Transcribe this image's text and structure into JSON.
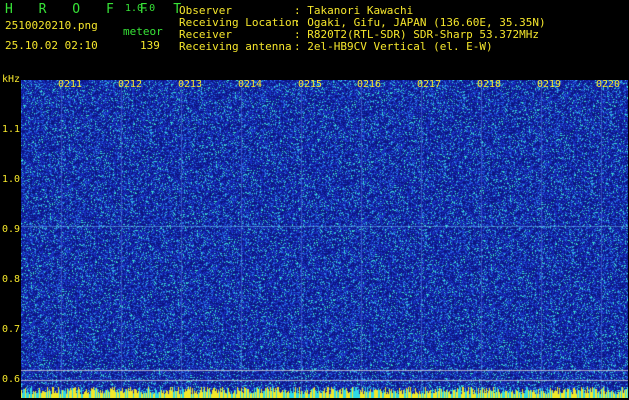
{
  "app": {
    "logo": "H R O F F T",
    "version": "1.0.0"
  },
  "left_info": {
    "filename": "2510020210.png",
    "mode_label": "meteor",
    "datetime": "25.10.02 02:10",
    "count": "139"
  },
  "station": [
    {
      "label": "Observer",
      "value": ": Takanori Kawachi"
    },
    {
      "label": "Receiving Location",
      "value": ": Ogaki, Gifu, JAPAN (136.60E, 35.35N)"
    },
    {
      "label": "Receiver",
      "value": ": R820T2(RTL-SDR) SDR-Sharp 53.372MHz"
    },
    {
      "label": "Receiving antenna",
      "value": ": 2el-HB9CV Vertical (el. E-W)"
    }
  ],
  "axis": {
    "y_unit": "kHz",
    "y_ticks": [
      "1.1",
      "1.0",
      "0.9",
      "0.8",
      "0.7",
      "0.6"
    ],
    "x_ticks": [
      "0211",
      "0212",
      "0213",
      "0214",
      "0215",
      "0216",
      "0217",
      "0218",
      "0219",
      "0220"
    ]
  },
  "colors": {
    "background": "#000000",
    "spectrogram": "#1a2fb8",
    "text_yellow": "#f5e62c",
    "text_green": "#37e337"
  }
}
